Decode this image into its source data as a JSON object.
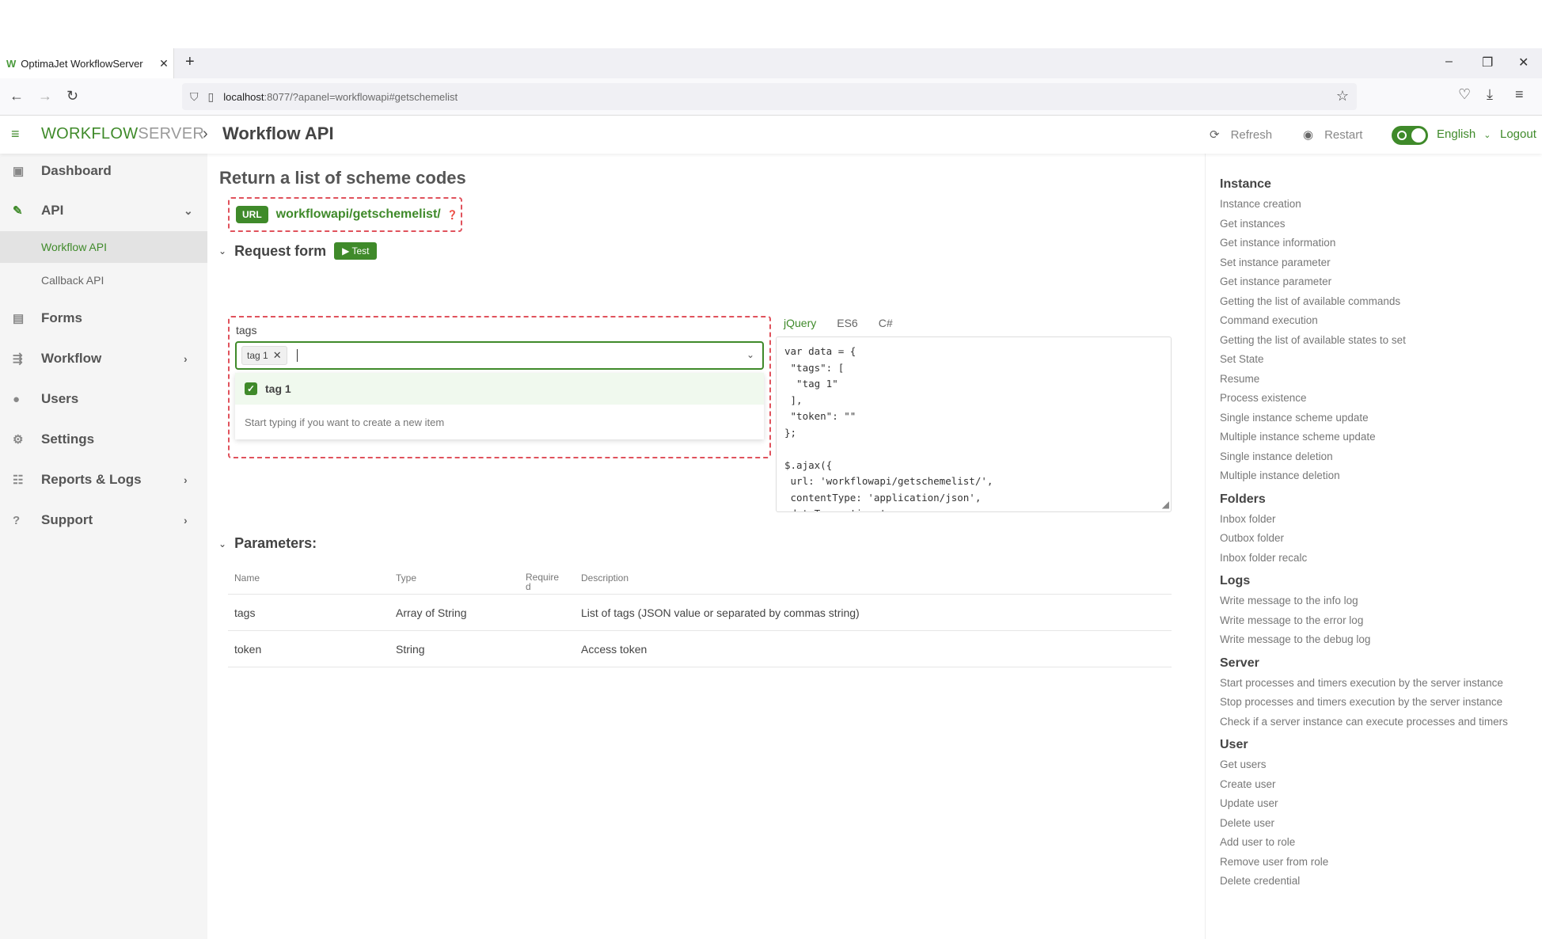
{
  "browser": {
    "tab_title": "OptimaJet WorkflowServer",
    "url_host": "localhost",
    "url_path": ":8077/?apanel=workflowapi#getschemelist"
  },
  "header": {
    "logo_bold": "WORKFLOW",
    "logo_light": "SERVER",
    "page_title": "Workflow API",
    "refresh_label": "Refresh",
    "restart_label": "Restart",
    "language": "English",
    "logout_label": "Logout"
  },
  "sidebar": {
    "items": [
      {
        "label": "Dashboard",
        "icon": "dashboard-icon"
      },
      {
        "label": "API",
        "icon": "plug-icon"
      },
      {
        "label": "Forms",
        "icon": "forms-icon"
      },
      {
        "label": "Workflow",
        "icon": "workflow-icon"
      },
      {
        "label": "Users",
        "icon": "users-icon"
      },
      {
        "label": "Settings",
        "icon": "settings-icon"
      },
      {
        "label": "Reports & Logs",
        "icon": "reports-icon"
      },
      {
        "label": "Support",
        "icon": "help-icon"
      }
    ],
    "sub_items": [
      "Workflow API",
      "Callback API"
    ]
  },
  "main": {
    "section_title": "Return a list of scheme codes",
    "url_badge": "URL",
    "url_text": "workflowapi/getschemelist/",
    "request_form_label": "Request form",
    "test_button": "Test",
    "tags_label": "tags",
    "chip_label": "tag 1",
    "option_label": "tag 1",
    "hint_text": "Start typing if you want to create a new item",
    "code_tabs": [
      "jQuery",
      "ES6",
      "C#"
    ],
    "code": "var data = {\n \"tags\": [\n  \"tag 1\"\n ],\n \"token\": \"\"\n};\n\n$.ajax({\n url: 'workflowapi/getschemelist/',\n contentType: 'application/json',\n dataType: 'json',",
    "parameters_label": "Parameters:",
    "param_headers": [
      "Name",
      "Type",
      "Require\nd",
      "Description"
    ],
    "params": [
      {
        "name": "tags",
        "type": "Array of String",
        "required": "",
        "description": "List of tags (JSON value or separated by commas string)"
      },
      {
        "name": "token",
        "type": "String",
        "required": "",
        "description": "Access token"
      }
    ]
  },
  "right_panel": {
    "groups": [
      {
        "title": "Instance",
        "links": [
          "Instance creation",
          "Get instances",
          "Get instance information",
          "Set instance parameter",
          "Get instance parameter",
          "Getting the list of available commands",
          "Command execution",
          "Getting the list of available states to set",
          "Set State",
          "Resume",
          "Process existence",
          "Single instance scheme update",
          "Multiple instance scheme update",
          "Single instance deletion",
          "Multiple instance deletion"
        ]
      },
      {
        "title": "Folders",
        "links": [
          "Inbox folder",
          "Outbox folder",
          "Inbox folder recalc"
        ]
      },
      {
        "title": "Logs",
        "links": [
          "Write message to the info log",
          "Write message to the error log",
          "Write message to the debug log"
        ]
      },
      {
        "title": "Server",
        "links": [
          "Start processes and timers execution by the server instance",
          "Stop processes and timers execution by the server instance",
          "Check if a server instance can execute processes and timers"
        ]
      },
      {
        "title": "User",
        "links": [
          "Get users",
          "Create user",
          "Update user",
          "Delete user",
          "Add user to role",
          "Remove user from role",
          "Delete credential"
        ]
      }
    ]
  },
  "colors": {
    "accent": "#3f8a2a",
    "dashed": "#e0525c"
  }
}
